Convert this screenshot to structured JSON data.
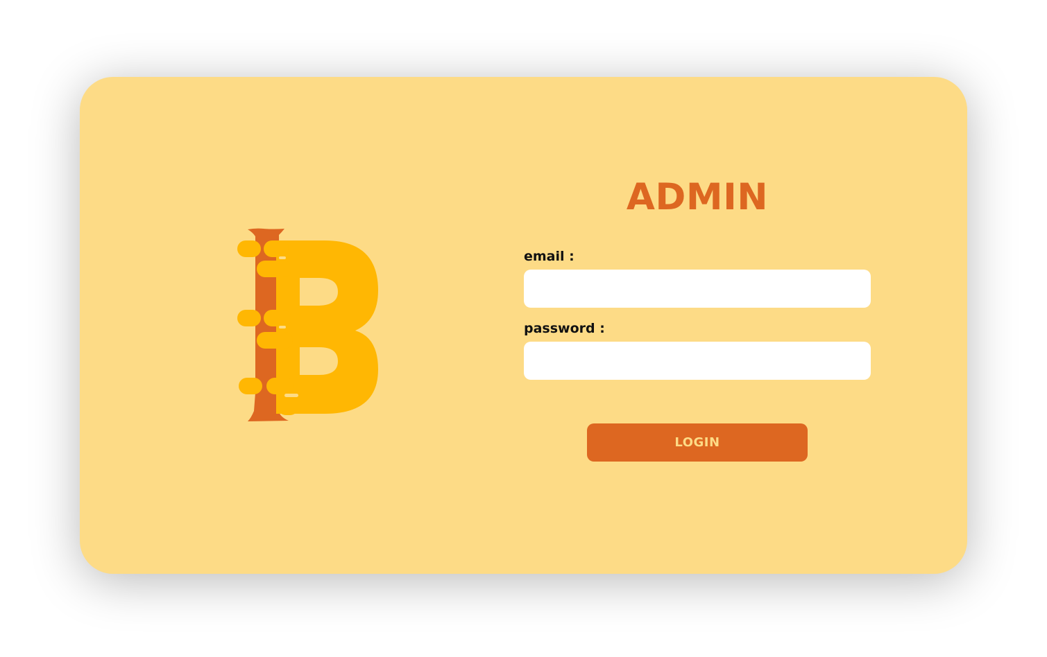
{
  "colors": {
    "page_background": "#ffffff",
    "card_background": "#fddb86",
    "accent": "#dd6721",
    "logo_primary": "#ffb703",
    "logo_spine": "#dd6721",
    "input_background": "#ffffff"
  },
  "logo": {
    "icon": "b-letter-logo-icon"
  },
  "form": {
    "title": "ADMIN",
    "email_label": "email :",
    "email_value": "",
    "password_label": "password :",
    "password_value": "",
    "login_label": "LOGIN"
  }
}
